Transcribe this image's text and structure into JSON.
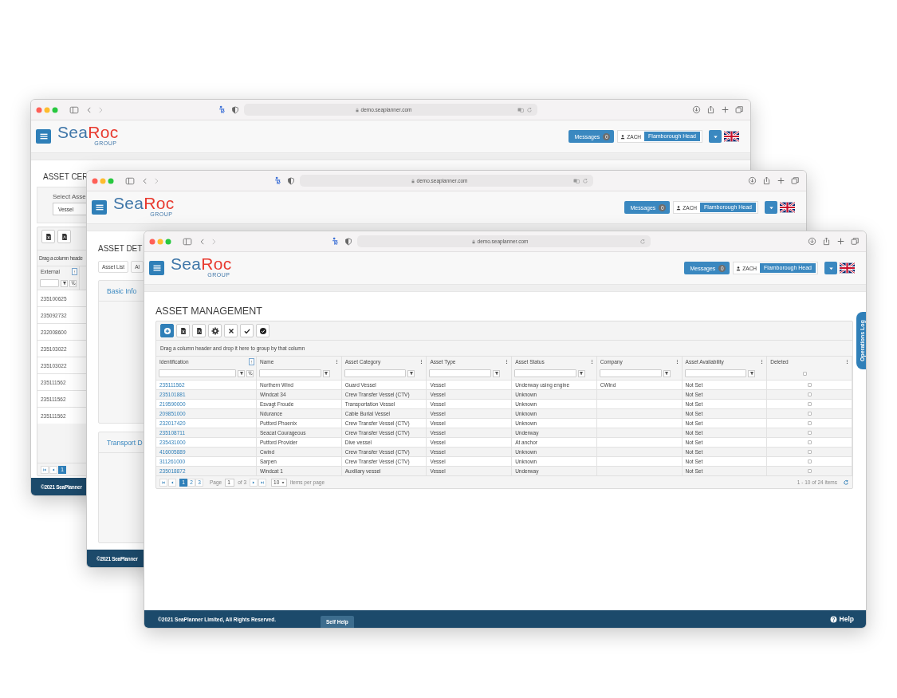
{
  "windows": [
    {
      "kind": "certificates",
      "browser": {
        "url": "demo.seaplanner.com",
        "translate": true
      },
      "header": {
        "logo": {
          "parts": [
            "Sea",
            "Roc"
          ],
          "tagline": "GROUP"
        },
        "messages": {
          "label": "Messages",
          "count": "0"
        },
        "user": "ZACH",
        "location": "Flamborough Head"
      },
      "page": {
        "title": "ASSET CER",
        "select_label": "Select Asse",
        "select_value": "Vessel",
        "toolbar": [
          {
            "kind": "excel"
          },
          {
            "kind": "pdf"
          }
        ],
        "group_hint": "Drag a column heade",
        "column": {
          "label": "External",
          "focused": true,
          "filter": {
            "kind": "text_clear"
          }
        },
        "rows": [
          "235100625",
          "235092732",
          "232008600",
          "235103022",
          "235103022",
          "235111562",
          "235111562",
          "235111562"
        ],
        "pages": [
          {
            "label": "1",
            "selected": true
          }
        ]
      },
      "footer": {
        "copyright": "©2021 SeaPlanner"
      }
    },
    {
      "kind": "details",
      "browser": {
        "url": "demo.seaplanner.com",
        "translate": true
      },
      "header": {
        "logo": {
          "parts": [
            "Sea",
            "Roc"
          ],
          "tagline": "GROUP"
        },
        "messages": {
          "label": "Messages",
          "count": "0"
        },
        "user": "ZACH",
        "location": "Flamborough Head"
      },
      "page": {
        "title": "ASSET DET",
        "tabs": [
          {
            "label": "Asset List",
            "selected": false
          },
          {
            "label": "Al",
            "selected": false
          }
        ],
        "panels": [
          "Basic Info",
          "Transport D"
        ]
      },
      "footer": {
        "copyright": "©2021 SeaPlanner"
      }
    },
    {
      "kind": "management",
      "browser": {
        "url": "demo.seaplanner.com",
        "translate": false
      },
      "header": {
        "logo": {
          "parts": [
            "Sea",
            "Roc"
          ],
          "tagline": "GROUP"
        },
        "messages": {
          "label": "Messages",
          "count": "0"
        },
        "user": "ZACH",
        "location": "Flamborough Head"
      },
      "page": {
        "title": "ASSET MANAGEMENT",
        "toolbar": [
          {
            "kind": "add"
          },
          {
            "kind": "excel"
          },
          {
            "kind": "pdf"
          },
          {
            "kind": "settings"
          },
          {
            "kind": "cancel"
          },
          {
            "kind": "save"
          },
          {
            "kind": "approve"
          }
        ],
        "group_hint": "Drag a column header and drop it here to group by that column",
        "columns": [
          {
            "label": "Identification",
            "focused": true,
            "filter": {
              "kind": "text_clear"
            }
          },
          {
            "label": "Name",
            "focused": false,
            "filter": {
              "kind": "text"
            }
          },
          {
            "label": "Asset Category",
            "focused": false,
            "filter": {
              "kind": "text"
            }
          },
          {
            "label": "Asset Type",
            "focused": false,
            "filter": {
              "kind": "text"
            }
          },
          {
            "label": "Asset Status",
            "focused": false,
            "filter": {
              "kind": "text"
            }
          },
          {
            "label": "Company",
            "focused": false,
            "filter": {
              "kind": "text"
            }
          },
          {
            "label": "Asset Availability",
            "focused": false,
            "filter": {
              "kind": "text"
            }
          },
          {
            "label": "Deleted",
            "focused": false,
            "filter": {
              "kind": "checkbox",
              "checked": false
            }
          }
        ],
        "rows": [
          {
            "identification": "235111562",
            "name": "Northern Wind",
            "category": "Guard Vessel",
            "type": "Vessel",
            "status": "Underway using engine",
            "company": "CWind",
            "availability": "Not Set",
            "deleted": false
          },
          {
            "identification": "235101881",
            "name": "Windcat 34",
            "category": "Crew Transfer Vessel (CTV)",
            "type": "Vessel",
            "status": "Unknown",
            "availability": "Not Set",
            "deleted": false
          },
          {
            "identification": "219590000",
            "name": "Esvagt Froude",
            "category": "Transportation Vessel",
            "type": "Vessel",
            "status": "Unknown",
            "availability": "Not Set",
            "deleted": false
          },
          {
            "identification": "209851000",
            "name": "Ndurance",
            "category": "Cable Burial Vessel",
            "type": "Vessel",
            "status": "Unknown",
            "availability": "Not Set",
            "deleted": false
          },
          {
            "identification": "232017420",
            "name": "Putford Phoenix",
            "category": "Crew Transfer Vessel (CTV)",
            "type": "Vessel",
            "status": "Unknown",
            "availability": "Not Set",
            "deleted": false
          },
          {
            "identification": "235108711",
            "name": "Seacat Courageous",
            "category": "Crew Transfer Vessel (CTV)",
            "type": "Vessel",
            "status": "Underway",
            "availability": "Not Set",
            "deleted": false
          },
          {
            "identification": "235431000",
            "name": "Putford Provider",
            "category": "Dive vessel",
            "type": "Vessel",
            "status": "At anchor",
            "availability": "Not Set",
            "deleted": false
          },
          {
            "identification": "416005889",
            "name": "Cwind",
            "category": "Crew Transfer Vessel (CTV)",
            "type": "Vessel",
            "status": "Unknown",
            "availability": "Not Set",
            "deleted": false
          },
          {
            "identification": "311261000",
            "name": "Sarpen",
            "category": "Crew Transfer Vessel (CTV)",
            "type": "Vessel",
            "status": "Unknown",
            "availability": "Not Set",
            "deleted": false
          },
          {
            "identification": "235018872",
            "name": "Windcat 1",
            "category": "Auxiliary vessel",
            "type": "Vessel",
            "status": "Underway",
            "availability": "Not Set",
            "deleted": false
          }
        ],
        "pager": {
          "pages": [
            {
              "label": "1",
              "selected": true
            },
            {
              "label": "2",
              "selected": false
            },
            {
              "label": "3",
              "selected": false
            }
          ],
          "page_label": "Page",
          "page_value": "1",
          "page_count": "of 3",
          "page_size": "10",
          "size_label": "items per page",
          "summary": "1 - 10 of 24 items"
        },
        "side_tab": "Operations Log"
      },
      "footer": {
        "copyright": "©2021 SeaPlanner Limited, All Rights Reserved.",
        "self_help": "Self Help",
        "help": "Help"
      }
    }
  ]
}
